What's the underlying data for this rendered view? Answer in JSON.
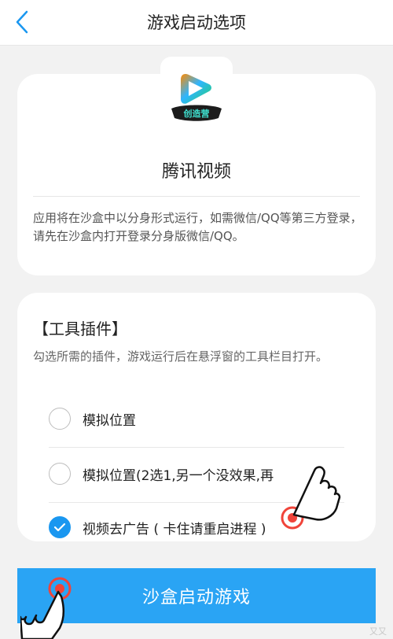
{
  "header": {
    "title": "游戏启动选项"
  },
  "app": {
    "logo_text": "创造营",
    "name": "腾讯视频",
    "description": "应用将在沙盒中以分身形式运行，如需微信/QQ等第三方登录，请先在沙盒内打开登录分身版微信/QQ。"
  },
  "tools": {
    "title": "【工具插件】",
    "description": "勾选所需的插件，游戏运行后在悬浮窗的工具栏目打开。",
    "options": [
      {
        "label": "模拟位置",
        "checked": false
      },
      {
        "label": "模拟位置(2选1,另一个没效果,再",
        "checked": false
      },
      {
        "label": "视频去广告 ( 卡住请重启进程 )",
        "checked": true
      }
    ]
  },
  "start_button": {
    "label": "沙盒启动游戏"
  },
  "watermark": "又又",
  "colors": {
    "accent": "#2aa4f4",
    "checked": "#1a97f0",
    "tap_marker": "#f0443a"
  },
  "icons": {
    "back": "chevron-left-icon",
    "hand": "pointing-hand-icon",
    "check": "check-icon"
  }
}
